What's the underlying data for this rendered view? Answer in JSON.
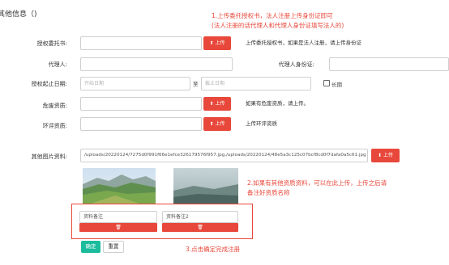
{
  "section": {
    "title": "其他信息（)"
  },
  "annotations": {
    "note1_line1": "1.上传委托授权书，法人注册上传身份证即可",
    "note1_line2": "(法人注册的话代理人和代理人身份证填写法人的)",
    "note2_line1": "2.如果有其他资质资料，可以在此上传，上传之后请",
    "note2_line2": "备注好资质名称",
    "note3": "3.点击确定完成注册"
  },
  "form": {
    "auth_letter": {
      "label": "授权委托书:",
      "upload_label": "上传",
      "hint": "上传委托授权书，如果是法人注册，请上传身份证"
    },
    "agent": {
      "label": "代理人:",
      "value": ""
    },
    "agent_id": {
      "label": "代理人身份证:",
      "value": ""
    },
    "auth_period": {
      "label": "授权起止日期:",
      "start_placeholder": "开始日期",
      "separator": "至",
      "end_placeholder": "截止日期",
      "long_term_label": "长期"
    },
    "hazard_qual": {
      "label": "危废资质:",
      "upload_label": "上传",
      "hint": "如果有危废资质，请上传。"
    },
    "env_eval": {
      "label": "环评资质:",
      "upload_label": "上传",
      "hint": "上传环评资质"
    },
    "other_images": {
      "label": "其他图片资料:",
      "value": "/uploads/20220124/7275d0f991f66e1efce326179576f957.jpg,/uploads/20220124/48e5a3c125c07bcf8cd0f7dafa0a5c61.jpg",
      "upload_label": "上传",
      "items": [
        {
          "remark": "资料备注",
          "image": "mountain-meadow"
        },
        {
          "remark": "资料备注2",
          "image": "misty-landscape"
        }
      ]
    }
  },
  "actions": {
    "confirm": "确定",
    "reset": "重置"
  },
  "colors": {
    "accent_red": "#e8483b",
    "confirm_green": "#1abc9c"
  }
}
